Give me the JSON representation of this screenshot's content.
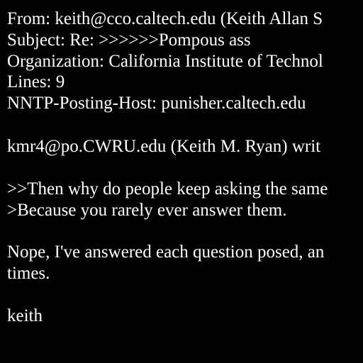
{
  "header": {
    "from": "From: keith@cco.caltech.edu (Keith Allan S",
    "subject": "Subject: Re: >>>>>>Pompous ass",
    "organization": "Organization: California Institute of Technol",
    "lines": "Lines: 9",
    "nntp_posting_host": "NNTP-Posting-Host: punisher.caltech.edu"
  },
  "body": {
    "attribution": "kmr4@po.CWRU.edu (Keith M. Ryan) writ",
    "quote_1": ">>Then why do people keep asking the same",
    "quote_2": ">Because you rarely ever answer them.",
    "reply_1": "Nope, I've answered each question posed, an",
    "reply_2": "times.",
    "signature": "keith"
  },
  "colors": {
    "background": "#000000",
    "text": "#ffffff"
  }
}
